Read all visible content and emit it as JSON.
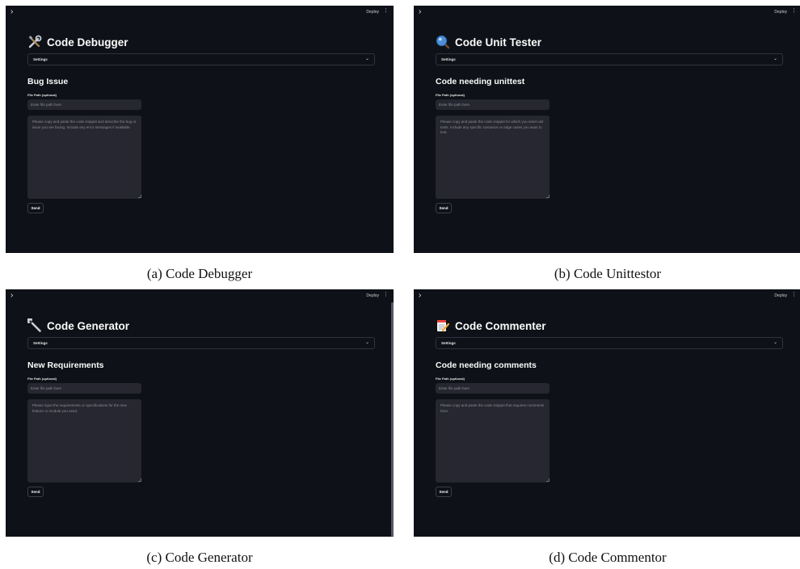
{
  "panels": [
    {
      "icon": "tools-icon",
      "title": "Code Debugger",
      "settings_label": "Settings",
      "section_heading": "Bug Issue",
      "file_path_label": "File Path (optional)",
      "file_path_placeholder": "Enter file path here",
      "textarea_placeholder": "Please copy and paste the code snippet and describe the bug or issue you are facing. Include any error messages if available.",
      "send_label": "Send",
      "deploy_label": "Deploy",
      "caption": "(a) Code Debugger",
      "menu_glyph": "⋮",
      "chevron_glyph": "›",
      "caret_glyph": "⌄"
    },
    {
      "icon": "magnifier-icon",
      "title": "Code Unit Tester",
      "settings_label": "Settings",
      "section_heading": "Code needing unittest",
      "file_path_label": "File Path (optional)",
      "file_path_placeholder": "Enter file path here",
      "textarea_placeholder": "Please copy and paste the code snippet for which you need unit tests. Include any specific scenarios or edge cases you want to test.",
      "send_label": "Send",
      "deploy_label": "Deploy",
      "caption": "(b) Code Unittestor",
      "menu_glyph": "⋮",
      "chevron_glyph": "›",
      "caret_glyph": "⌄"
    },
    {
      "icon": "wrench-icon",
      "title": "Code Generator",
      "settings_label": "Settings",
      "section_heading": "New Requirements",
      "file_path_label": "File Path (optional)",
      "file_path_placeholder": "Enter file path here",
      "textarea_placeholder": "Please input the requirements or specifications for the new feature or module you need.",
      "send_label": "Send",
      "deploy_label": "Deploy",
      "caption": "(c) Code Generator",
      "menu_glyph": "⋮",
      "chevron_glyph": "›",
      "caret_glyph": "⌄"
    },
    {
      "icon": "memo-icon",
      "title": "Code Commenter",
      "settings_label": "Settings",
      "section_heading": "Code needing comments",
      "file_path_label": "File Path (optional)",
      "file_path_placeholder": "Enter file path here",
      "textarea_placeholder": "Please copy and paste the code snippet that requires comments here.",
      "send_label": "Send",
      "deploy_label": "Deploy",
      "caption": "(d) Code Commentor",
      "menu_glyph": "⋮",
      "chevron_glyph": "›",
      "caret_glyph": "⌄"
    }
  ],
  "colors": {
    "app_background": "#0e1117",
    "input_background": "#262730",
    "text": "#fafafa",
    "placeholder": "#8a8c93",
    "border": "#30333d"
  }
}
